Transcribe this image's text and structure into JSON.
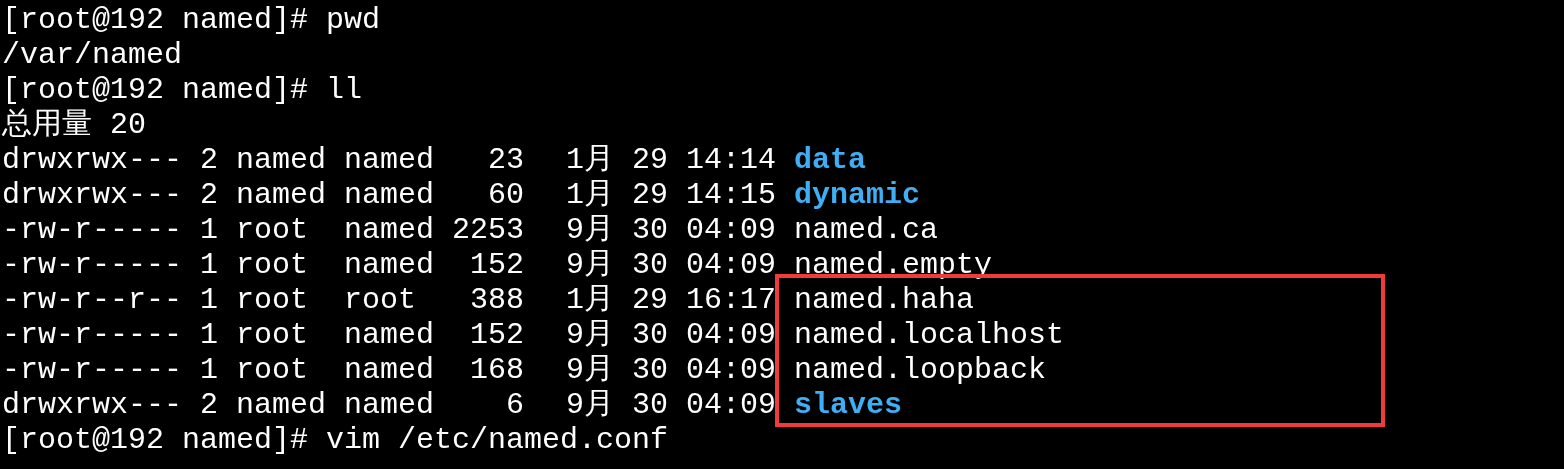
{
  "terminal": {
    "lines": [
      {
        "kind": "prompt",
        "prompt": "[root@192 named]#",
        "command": "pwd"
      },
      {
        "kind": "output",
        "text": "/var/named"
      },
      {
        "kind": "prompt",
        "prompt": "[root@192 named]#",
        "command": "ll"
      },
      {
        "kind": "output",
        "text": "总用量 20"
      },
      {
        "kind": "entry",
        "directory": true,
        "boxed": false,
        "perms": "drwxrwx---",
        "links": "2",
        "owner": "named",
        "group": "named",
        "size": "23",
        "month": "1月",
        "day": "29",
        "time": "14:14",
        "name": "data"
      },
      {
        "kind": "entry",
        "directory": true,
        "boxed": false,
        "perms": "drwxrwx---",
        "links": "2",
        "owner": "named",
        "group": "named",
        "size": "60",
        "month": "1月",
        "day": "29",
        "time": "14:15",
        "name": "dynamic"
      },
      {
        "kind": "entry",
        "directory": false,
        "boxed": false,
        "perms": "-rw-r-----",
        "links": "1",
        "owner": "root",
        "group": "named",
        "size": "2253",
        "month": "9月",
        "day": "30",
        "time": "04:09",
        "name": "named.ca"
      },
      {
        "kind": "entry",
        "directory": false,
        "boxed": false,
        "perms": "-rw-r-----",
        "links": "1",
        "owner": "root",
        "group": "named",
        "size": "152",
        "month": "9月",
        "day": "30",
        "time": "04:09",
        "name": "named.empty"
      },
      {
        "kind": "entry",
        "directory": false,
        "boxed": true,
        "perms": "-rw-r--r--",
        "links": "1",
        "owner": "root",
        "group": "root",
        "size": "388",
        "month": "1月",
        "day": "29",
        "time": "16:17",
        "name": "named.haha"
      },
      {
        "kind": "entry",
        "directory": false,
        "boxed": true,
        "perms": "-rw-r-----",
        "links": "1",
        "owner": "root",
        "group": "named",
        "size": "152",
        "month": "9月",
        "day": "30",
        "time": "04:09",
        "name": "named.localhost"
      },
      {
        "kind": "entry",
        "directory": false,
        "boxed": true,
        "perms": "-rw-r-----",
        "links": "1",
        "owner": "root",
        "group": "named",
        "size": "168",
        "month": "9月",
        "day": "30",
        "time": "04:09",
        "name": "named.loopback"
      },
      {
        "kind": "entry",
        "directory": true,
        "boxed": true,
        "perms": "drwxrwx---",
        "links": "2",
        "owner": "named",
        "group": "named",
        "size": "6",
        "month": "9月",
        "day": "30",
        "time": "04:09",
        "name": "slaves"
      },
      {
        "kind": "prompt",
        "prompt": "[root@192 named]#",
        "command": "vim /etc/named.conf"
      }
    ]
  }
}
